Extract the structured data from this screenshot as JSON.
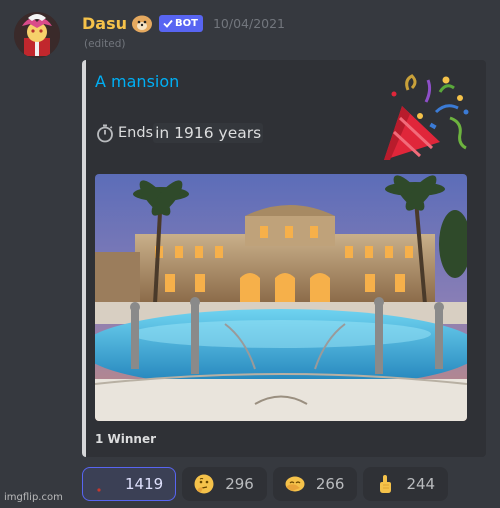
{
  "author": {
    "name": "Dasu",
    "bot_tag": "BOT",
    "timestamp": "10/04/2021",
    "edited": "(edited)"
  },
  "embed": {
    "title": "A mansion",
    "ends_label": "Ends",
    "ends_value": "in 1916 years",
    "footer": "1 Winner",
    "accent_color": "#d5d6d8"
  },
  "reactions": [
    {
      "icon": "giveaway-reaction-icon",
      "count": "1419",
      "active": true
    },
    {
      "icon": "thinking-face-icon",
      "count": "296",
      "active": false
    },
    {
      "icon": "hand-over-face-icon",
      "count": "266",
      "active": false
    },
    {
      "icon": "pointing-up-icon",
      "count": "244",
      "active": false
    }
  ],
  "watermark": "imgflip.com",
  "colors": {
    "background": "#36393f",
    "embed_bg": "#2f3136",
    "username": "#f5c24a",
    "bot_tag": "#5865f2",
    "title_link": "#00aff4"
  }
}
